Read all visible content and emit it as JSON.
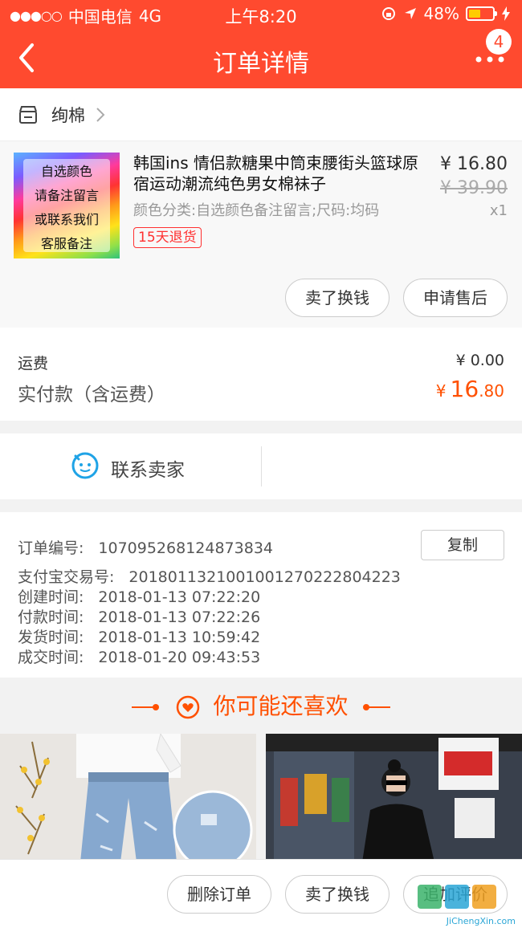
{
  "status_bar": {
    "carrier": "中国电信",
    "network": "4G",
    "time": "上午8:20",
    "battery": "48%"
  },
  "nav": {
    "title": "订单详情",
    "badge": "4"
  },
  "shop": {
    "name": "绚棉"
  },
  "product": {
    "thumb_lines": [
      "自选颜色",
      "请备注留言",
      "或联系我们",
      "客服备注"
    ],
    "title": "韩国ins 情侣款糖果中筒束腰街头篮球原宿运动潮流纯色男女棉袜子",
    "sku": "颜色分类:自选颜色备注留言;尺码:均码",
    "tag": "15天退货",
    "price": "¥ 16.80",
    "original_price": "¥ 39.90",
    "quantity": "x1",
    "actions": [
      "卖了换钱",
      "申请售后"
    ]
  },
  "fees": {
    "shipping_label": "运费",
    "shipping_value": "¥ 0.00",
    "paid_label": "实付款（含运费）",
    "paid_currency": "¥",
    "paid_int": "16",
    "paid_dec": ".80"
  },
  "contact": {
    "label": "联系卖家"
  },
  "order_info": {
    "order_no_label": "订单编号:",
    "order_no": "107095268124873834",
    "copy_label": "复制",
    "alipay_label": "支付宝交易号:",
    "alipay_no": "2018011321001001270222804223",
    "created_label": "创建时间:",
    "created": "2018-01-13 07:22:20",
    "paid_label": "付款时间:",
    "paid": "2018-01-13 07:22:26",
    "shipped_label": "发货时间:",
    "shipped": "2018-01-13 10:59:42",
    "closed_label": "成交时间:",
    "closed": "2018-01-20 09:43:53"
  },
  "recommend": {
    "title": "你可能还喜欢"
  },
  "bottom_bar": {
    "delete_label": "删除订单",
    "sell_label": "卖了换钱",
    "review_label": "追加评价"
  },
  "watermark": {
    "text": "JiChengXin.com"
  },
  "colors": {
    "brand": "#ff4a2f",
    "price_accent": "#ff5000",
    "tag": "#ff3030"
  }
}
